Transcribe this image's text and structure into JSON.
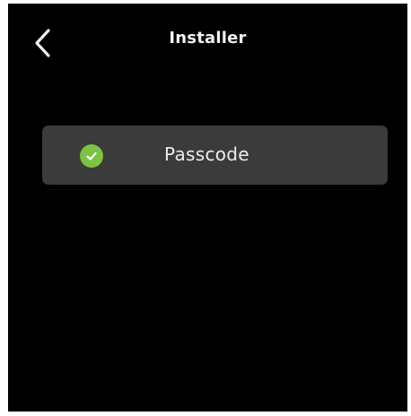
{
  "header": {
    "title": "Installer",
    "back_icon": "chevron-left-icon"
  },
  "menu": {
    "items": [
      {
        "label": "Passcode",
        "status_icon": "check-circle-icon",
        "status_color": "#7dc243"
      }
    ]
  },
  "colors": {
    "background": "#000000",
    "item_background": "#3b3b3b",
    "text": "#ececec"
  }
}
